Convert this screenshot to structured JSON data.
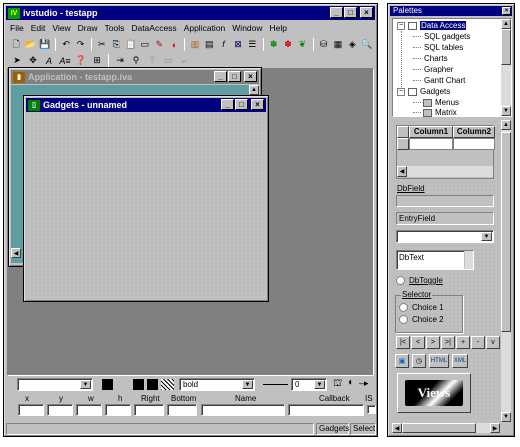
{
  "main_window": {
    "title": "ivstudio - testapp",
    "menu": [
      "File",
      "Edit",
      "View",
      "Draw",
      "Tools",
      "DataAccess",
      "Application",
      "Window",
      "Help"
    ],
    "title_buttons": [
      "_",
      "□",
      "×"
    ]
  },
  "app_window": {
    "title": "Application - testapp.iva"
  },
  "gadgets_window": {
    "title": "Gadgets - unnamed"
  },
  "inspector": {
    "font_value": "bold",
    "line_width": "0",
    "labels": {
      "x": "x",
      "y": "y",
      "w": "w",
      "h": "h",
      "right": "Right",
      "bottom": "Bottom",
      "name": "Name",
      "callback": "Callback",
      "is": "IS"
    }
  },
  "status_bar": {
    "left": "Gadgets",
    "right": "Selection"
  },
  "palettes": {
    "title": "Palettes",
    "tree": {
      "root": "Data Access",
      "children": [
        "SQL gadgets",
        "SQL tables",
        "Charts",
        "Grapher",
        "Gantt Chart"
      ],
      "second": "Gadgets",
      "second_children": [
        "Menus",
        "Matrix"
      ]
    },
    "table": {
      "col1": "Column1",
      "col2": "Column2"
    },
    "dbfield_label": "DbField",
    "entryfield_value": "EntryField",
    "dbtext_value": "DbText",
    "dbtoggle_label": "DbToggle",
    "selector": {
      "title": "Selector",
      "choices": [
        "Choice 1",
        "Choice 2"
      ]
    },
    "nav_buttons": [
      "|<",
      "<",
      ">",
      ">|",
      "+",
      "-",
      "v"
    ],
    "views_logo": "Views"
  }
}
